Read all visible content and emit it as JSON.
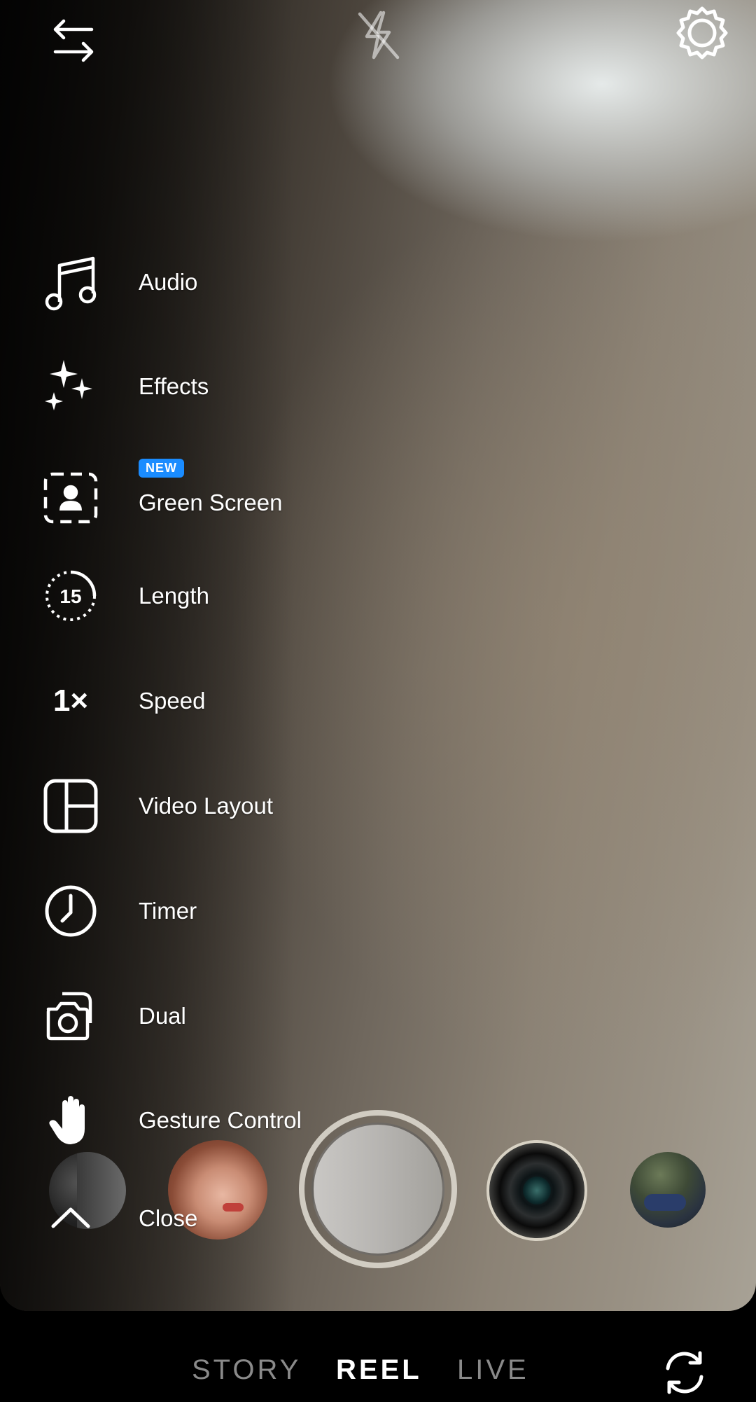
{
  "top_bar": {
    "switch_icon": "swap-arrows-icon",
    "flash_icon": "flash-off-icon",
    "settings_icon": "gear-icon"
  },
  "menu": {
    "items": [
      {
        "label": "Audio",
        "icon": "music-note-icon"
      },
      {
        "label": "Effects",
        "icon": "sparkles-icon"
      },
      {
        "label": "Green Screen",
        "icon": "green-screen-icon",
        "badge": "NEW"
      },
      {
        "label": "Length",
        "icon": "length-timer-icon",
        "icon_text": "15"
      },
      {
        "label": "Speed",
        "icon": "speed-icon",
        "icon_text": "1×"
      },
      {
        "label": "Video Layout",
        "icon": "layout-grid-icon"
      },
      {
        "label": "Timer",
        "icon": "clock-icon"
      },
      {
        "label": "Dual",
        "icon": "dual-camera-icon"
      },
      {
        "label": "Gesture Control",
        "icon": "hand-icon"
      },
      {
        "label": "Close",
        "icon": "chevron-up-icon"
      }
    ]
  },
  "capture": {
    "effects": [
      "portrait-effect",
      "face-effect",
      "shutter",
      "camera-lens-effect",
      "scene-effect"
    ]
  },
  "modes": {
    "items": [
      "STORY",
      "REEL",
      "LIVE"
    ],
    "active": "REEL"
  },
  "flip_camera_icon": "flip-camera-icon"
}
